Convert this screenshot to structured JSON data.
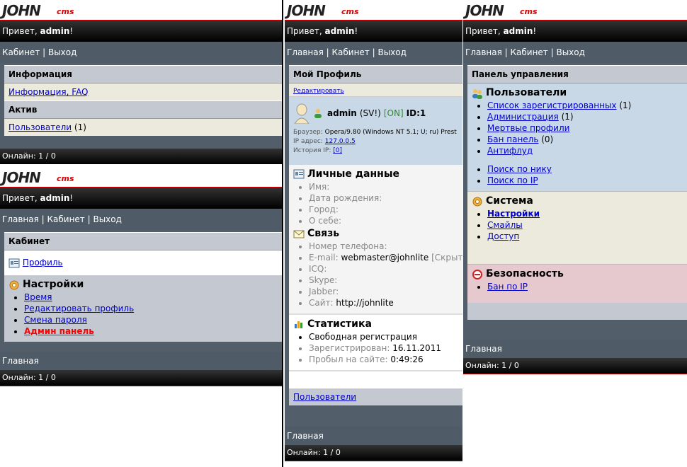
{
  "logo": {
    "main": "JOHN",
    "cms": "cms"
  },
  "greeting": {
    "prefix": "Привет, ",
    "user": "admin",
    "suffix": "!"
  },
  "online": "Онлайн: 1 / 0",
  "panel1": {
    "nav": "Кабинет | Выход",
    "info_header": "Информация",
    "info_link": "Информация, FAQ",
    "active_header": "Актив",
    "users_link": "Пользователи",
    "users_count": " (1)"
  },
  "panel2": {
    "nav": "Главная | Кабинет | Выход",
    "cabinet_header": "Кабинет",
    "profile_link": "Профиль",
    "settings_title": "Настройки",
    "settings_items": [
      "Время",
      "Редактировать профиль",
      "Смена пароля",
      "Админ панель"
    ],
    "footer_nav": "Главная"
  },
  "panel3": {
    "nav": "Главная | Кабинет | Выход",
    "profile_header": "Мой Профиль",
    "edit_link": "Редактировать",
    "user_name": "admin",
    "user_status": " (SV!) ",
    "user_on": "[ON]",
    "user_id": " ID:1",
    "browser_label": "Браузер: ",
    "browser_value": "Opera/9.80 (Windows NT 5.1; U; ru) Prest",
    "ip_label": "IP адрес: ",
    "ip_value": "127.0.0.5",
    "history_label": "История IP: ",
    "history_value": "[0]",
    "personal_title": "Личные данные",
    "personal_items": [
      "Имя:",
      "Дата рождения:",
      "Город:",
      "О себе:"
    ],
    "contact_title": "Связь",
    "contact_phone": "Номер телефона:",
    "contact_email_label": "E-mail: ",
    "contact_email": "webmaster@johnlite",
    "contact_hidden": " [Скрыт]",
    "contact_icq": "ICQ:",
    "contact_skype": "Skype:",
    "contact_jabber": "Jabber:",
    "contact_site_label": "Сайт: ",
    "contact_site": "http://johnlite",
    "stats_title": "Статистика",
    "stats_reg": "Свободная регистрация",
    "stats_registered_label": "Зарегистрирован: ",
    "stats_registered": "16.11.2011",
    "stats_time_label": "Пробыл на сайте: ",
    "stats_time": "0:49:26",
    "users_link": "Пользователи",
    "footer_nav": "Главная"
  },
  "panel4": {
    "nav": "Главная | Кабинет | Выход",
    "admin_header": "Панель управления",
    "users_title": "Пользователи",
    "users_items": [
      {
        "link": "Список зарегистрированных",
        "extra": " (1)"
      },
      {
        "link": "Администрация",
        "extra": " (1)"
      },
      {
        "link": "Мертвые профили",
        "extra": ""
      },
      {
        "link": "Бан панель",
        "extra": " (0)"
      },
      {
        "link": "Антифлуд",
        "extra": ""
      }
    ],
    "search_items": [
      "Поиск по нику",
      "Поиск по IP"
    ],
    "system_title": "Система",
    "system_items": [
      "Настройки",
      "Смайлы",
      "Доступ"
    ],
    "security_title": "Безопасность",
    "security_items": [
      "Бан по IP"
    ],
    "footer_nav": "Главная"
  },
  "colors": {
    "link": "#0000cc",
    "admin_link": "#ff0000",
    "on_status": "#2a8a2a",
    "brand": "#d80000"
  }
}
